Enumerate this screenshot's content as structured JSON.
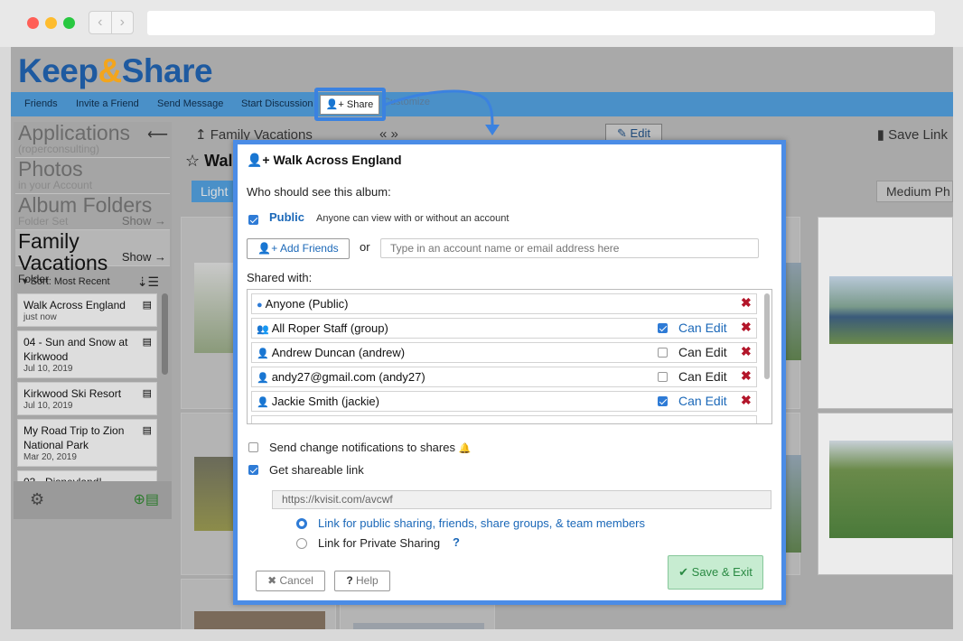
{
  "app": {
    "logo_keep": "Keep",
    "logo_amp": "&",
    "logo_share": "Share"
  },
  "menu": {
    "items": [
      "Friends",
      "Invite a Friend",
      "Send Message",
      "Start Discussion"
    ],
    "share_label": "Share",
    "customize_label": "Customize"
  },
  "sidebar": {
    "sections": [
      {
        "title": "Applications",
        "sub": "(roperconsulting)",
        "show": ""
      },
      {
        "title": "Photos",
        "sub": "in your Account",
        "show": ""
      },
      {
        "title": "Album Folders",
        "sub": "Folder Set",
        "show": "Show"
      },
      {
        "title": "Family Vacations",
        "sub": "Folder",
        "show": "Show"
      }
    ],
    "sort_label": "Sort: Most Recent",
    "albums": [
      {
        "title": "Walk Across England",
        "date": "just now"
      },
      {
        "title": "04 - Sun and Snow at Kirkwood",
        "date": "Jul 10, 2019"
      },
      {
        "title": "Kirkwood Ski Resort",
        "date": "Jul 10, 2019"
      },
      {
        "title": "My Road Trip to Zion National Park",
        "date": "Mar 20, 2019"
      },
      {
        "title": "03 - Disneyland!",
        "date": ""
      }
    ]
  },
  "album_header": {
    "breadcrumb": "Family Vacations",
    "nav_arrows": "«   »",
    "edit_label": "Edit",
    "save_link_label": "Save Link",
    "album_title_partial": "Wall",
    "light_label": "Light",
    "medium_label": "Medium Ph"
  },
  "dialog": {
    "title": "Walk Across England",
    "who_label": "Who should see this album:",
    "public_label": "Public",
    "public_desc": "Anyone can view with or without an account",
    "add_friends_label": "Add Friends",
    "or_label": "or",
    "account_placeholder": "Type in an account name or email address here",
    "shared_with_label": "Shared with:",
    "can_edit_label": "Can Edit",
    "shares": [
      {
        "name": "Anyone (Public)",
        "icon": "globe-icon",
        "can_edit": null
      },
      {
        "name": "All Roper Staff (group)",
        "icon": "group-icon",
        "can_edit": true
      },
      {
        "name": "Andrew Duncan (andrew)",
        "icon": "user-icon",
        "can_edit": false
      },
      {
        "name": "andy27@gmail.com (andy27)",
        "icon": "user-icon",
        "can_edit": false
      },
      {
        "name": "Jackie Smith (jackie)",
        "icon": "user-icon",
        "can_edit": true
      }
    ],
    "notify_label": "Send change notifications to shares",
    "shareable_link_label": "Get shareable link",
    "link_url": "https://kvisit.com/avcwf",
    "radio_public_label": "Link for public sharing, friends, share groups, & team members",
    "radio_private_label": "Link for Private Sharing",
    "private_help": "?",
    "cancel_label": "Cancel",
    "help_label": "Help",
    "save_exit_label": "Save & Exit"
  },
  "colors": {
    "accent": "#4b8ce6",
    "brand_blue": "#1e5aa0",
    "brand_orange": "#f3a51c",
    "link_blue": "#1b68b8",
    "remove_red": "#b3162a",
    "save_green": "#2a8a43"
  }
}
